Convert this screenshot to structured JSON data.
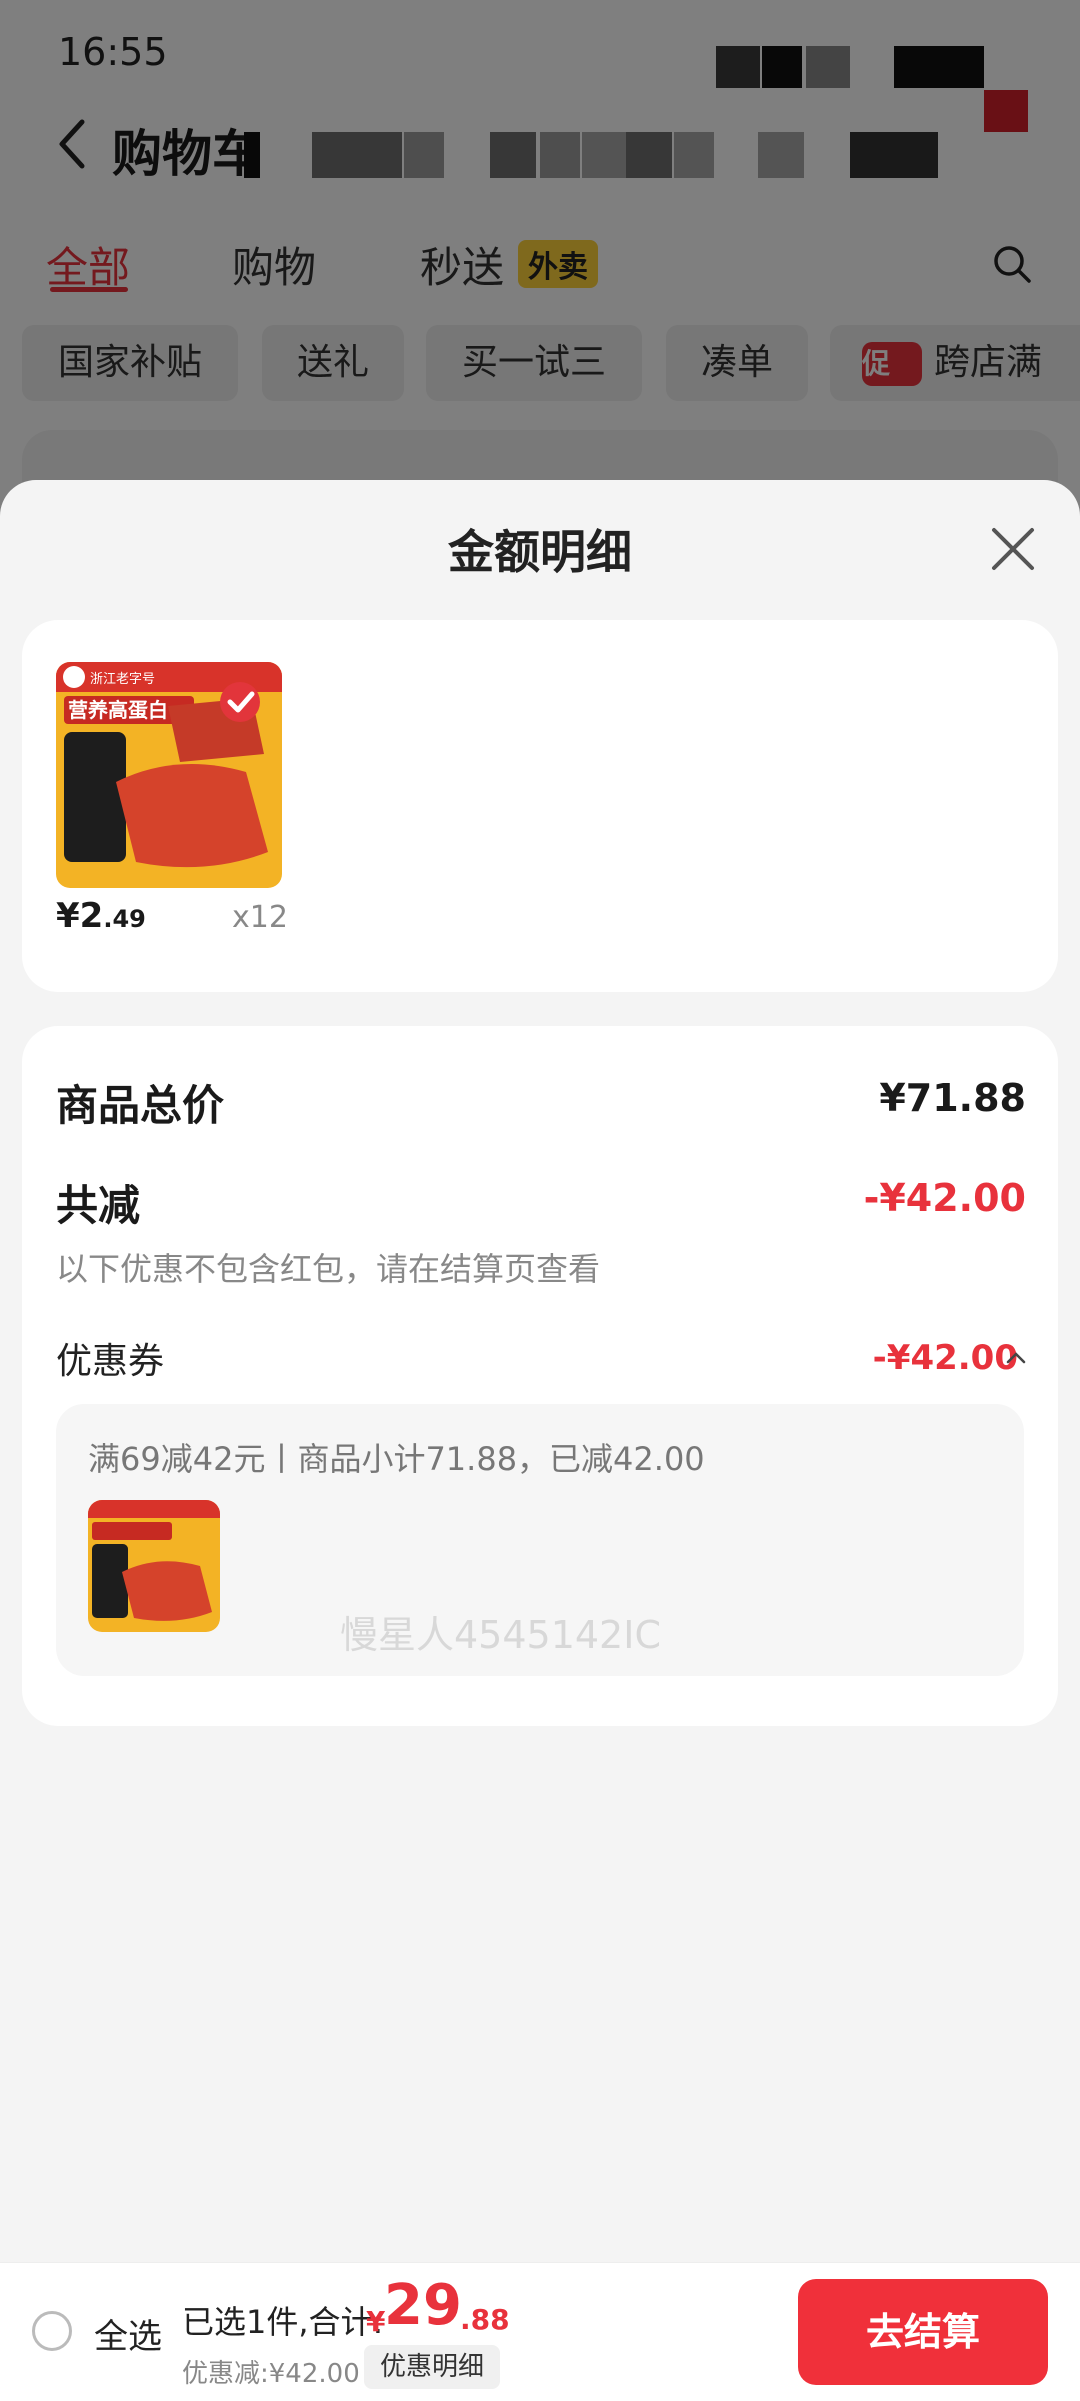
{
  "status_bar": {
    "time": "16:55"
  },
  "header": {
    "title": "购物车"
  },
  "tabs": [
    {
      "label": "全部",
      "active": true
    },
    {
      "label": "购物",
      "active": false
    },
    {
      "label": "秒送",
      "active": false,
      "badge": "外卖"
    }
  ],
  "chips": [
    "国家补贴",
    "送礼",
    "买一试三",
    "凑单",
    {
      "badge": "促",
      "label": "跨店满"
    }
  ],
  "sheet": {
    "title": "金额明细",
    "product": {
      "price_int": "¥2",
      "price_dec": ".49",
      "quantity": "x12",
      "image_text": "营养高蛋白"
    },
    "breakdown": {
      "total_label": "商品总价",
      "total_value": "¥71.88",
      "reduce_label": "共减",
      "reduce_value": "-¥42.00",
      "note": "以下优惠不包含红包，请在结算页查看",
      "coupon_label": "优惠券",
      "coupon_value": "-¥42.00",
      "coupon_desc": "满69减42元丨商品小计71.88，已减42.00"
    }
  },
  "watermark": "慢星人4545142IC",
  "bottom_bar": {
    "select_all": "全选",
    "summary": "已选1件,合计:",
    "total_symbol": "¥",
    "total_int": "29",
    "total_dec": ".88",
    "discount": "优惠减:¥42.00",
    "detail_button": "优惠明细",
    "checkout_button": "去结算"
  },
  "colors": {
    "accent": "#e8323c",
    "checkout": "#f0303a",
    "badge_yellow": "#ffd23a"
  }
}
